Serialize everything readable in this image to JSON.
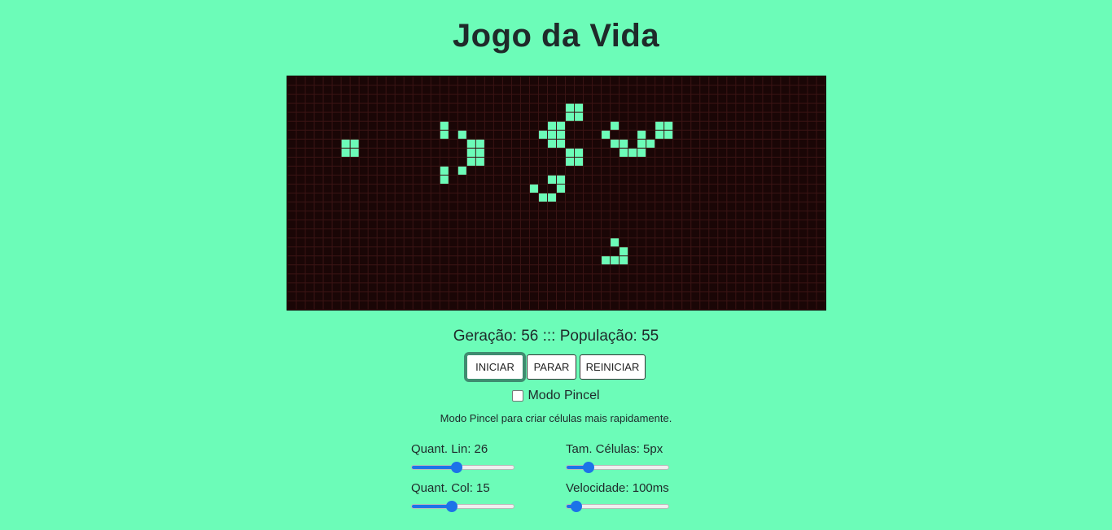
{
  "title": "Jogo da Vida",
  "board": {
    "columns": 60,
    "rows": 26,
    "alive_color": "#6cfcb8",
    "dead_color": "#1a0606",
    "grid_color": "#3a1414",
    "alive_cells": [
      [
        6,
        7
      ],
      [
        7,
        7
      ],
      [
        6,
        8
      ],
      [
        7,
        8
      ],
      [
        17,
        5
      ],
      [
        17,
        6
      ],
      [
        19,
        6
      ],
      [
        20,
        7
      ],
      [
        21,
        7
      ],
      [
        20,
        8
      ],
      [
        21,
        8
      ],
      [
        20,
        9
      ],
      [
        21,
        9
      ],
      [
        17,
        10
      ],
      [
        19,
        10
      ],
      [
        17,
        11
      ],
      [
        31,
        3
      ],
      [
        32,
        3
      ],
      [
        31,
        4
      ],
      [
        32,
        4
      ],
      [
        28,
        6
      ],
      [
        29,
        5
      ],
      [
        30,
        5
      ],
      [
        29,
        6
      ],
      [
        30,
        6
      ],
      [
        29,
        7
      ],
      [
        30,
        7
      ],
      [
        31,
        8
      ],
      [
        32,
        8
      ],
      [
        31,
        9
      ],
      [
        32,
        9
      ],
      [
        29,
        11
      ],
      [
        30,
        11
      ],
      [
        27,
        12
      ],
      [
        30,
        12
      ],
      [
        28,
        13
      ],
      [
        29,
        13
      ],
      [
        36,
        5
      ],
      [
        35,
        6
      ],
      [
        36,
        7
      ],
      [
        37,
        7
      ],
      [
        37,
        8
      ],
      [
        38,
        8
      ],
      [
        39,
        7
      ],
      [
        39,
        8
      ],
      [
        40,
        7
      ],
      [
        39,
        6
      ],
      [
        41,
        6
      ],
      [
        41,
        5
      ],
      [
        42,
        5
      ],
      [
        42,
        6
      ],
      [
        36,
        18
      ],
      [
        35,
        20
      ],
      [
        36,
        20
      ],
      [
        37,
        19
      ],
      [
        37,
        20
      ]
    ]
  },
  "status": {
    "generation_label": "Geração:",
    "generation_value": "56",
    "separator": ":::",
    "population_label": "População:",
    "population_value": "55"
  },
  "buttons": {
    "start": "INICIAR",
    "stop": "PARAR",
    "restart": "REINICIAR"
  },
  "brush": {
    "label": "Modo Pincel",
    "checked": false
  },
  "hint": "Modo Pincel para criar células mais rapidamente.",
  "controls": {
    "rows": {
      "label": "Quant. Lin: 26",
      "fraction": 0.43
    },
    "cell_size": {
      "label": "Tam. Células: 5px",
      "fraction": 0.19
    },
    "cols": {
      "label": "Quant. Col: 15",
      "fraction": 0.38
    },
    "speed": {
      "label": "Velocidade: 100ms",
      "fraction": 0.05
    }
  },
  "colors": {
    "page_background": "#6cfcb8",
    "slider_accent": "#1c73e8"
  }
}
